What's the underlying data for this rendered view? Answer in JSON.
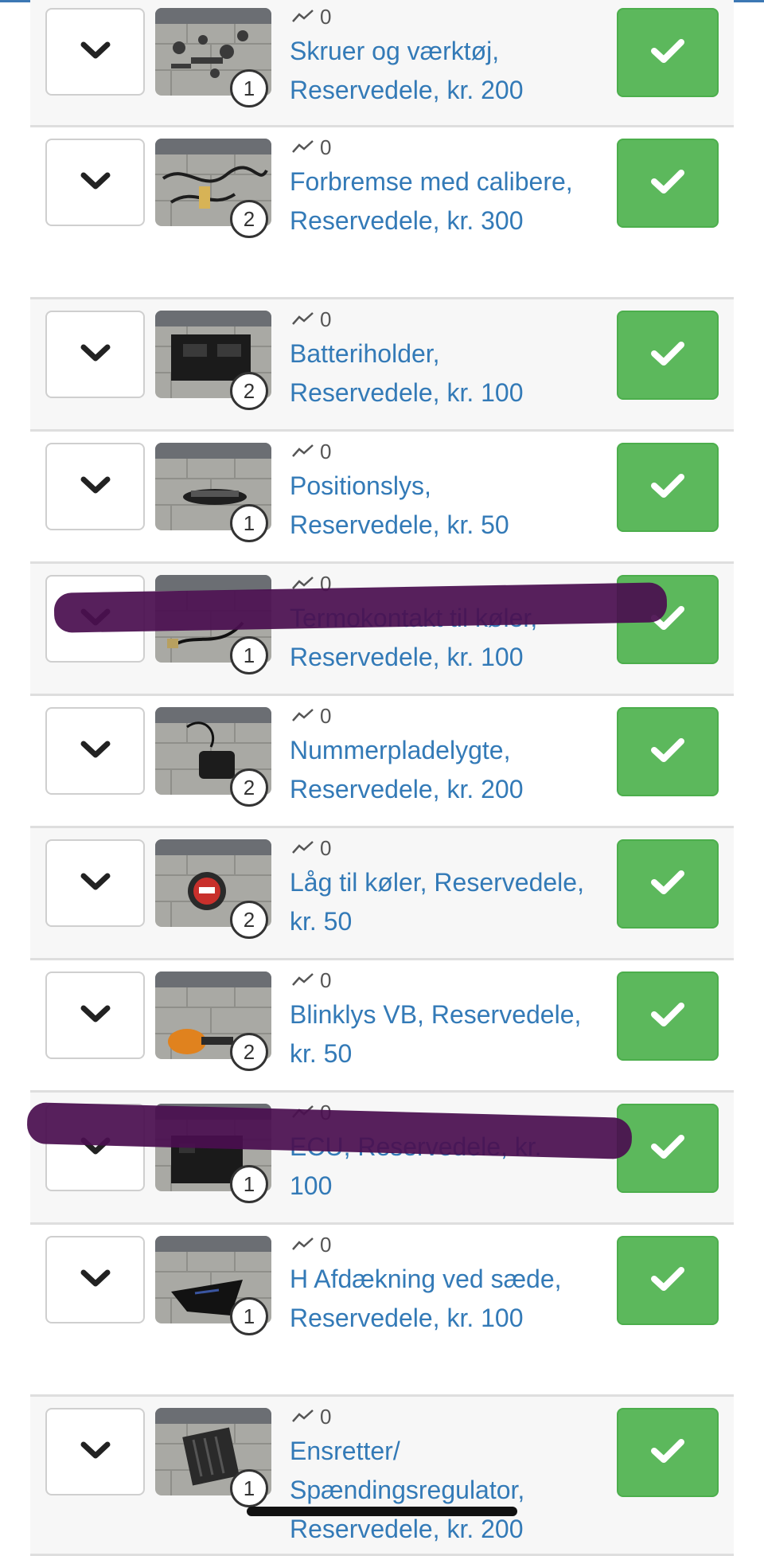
{
  "listing": {
    "items": [
      {
        "title": "Skruer og værktøj, Reservedele, kr. 200",
        "views": "0",
        "image_count": "1",
        "photo": "small-parts"
      },
      {
        "title": "Forbremse med calibere, Reservedele, kr. 300",
        "views": "0",
        "image_count": "2",
        "photo": "brake-cables"
      },
      {
        "title": "Batteriholder, Reservedele, kr. 100",
        "views": "0",
        "image_count": "2",
        "photo": "battery-holder"
      },
      {
        "title": "Positionslys, Reservedele, kr. 50",
        "views": "0",
        "image_count": "1",
        "photo": "position-light"
      },
      {
        "title": "Termokontakt til køler, Reservedele, kr. 100",
        "views": "0",
        "image_count": "1",
        "photo": "thermo-switch",
        "redacted": true
      },
      {
        "title": "Nummerpladelygte, Reservedele, kr. 200",
        "views": "0",
        "image_count": "2",
        "photo": "plate-light"
      },
      {
        "title": "Låg til køler, Reservedele, kr. 50",
        "views": "0",
        "image_count": "2",
        "photo": "radiator-cap"
      },
      {
        "title": "Blinklys VB, Reservedele, kr. 50",
        "views": "0",
        "image_count": "2",
        "photo": "turn-signal"
      },
      {
        "title": "ECU, Reservedele, kr. 100",
        "views": "0",
        "image_count": "1",
        "photo": "ecu",
        "redacted": true
      },
      {
        "title": "H Afdækning ved sæde, Reservedele, kr. 100",
        "views": "0",
        "image_count": "1",
        "photo": "seat-cover"
      },
      {
        "title": "Ensretter/ Spændingsregulator, Reservedele, kr. 200",
        "views": "0",
        "image_count": "1",
        "photo": "rectifier"
      }
    ]
  },
  "icons": {
    "expand": "chevron-down-icon",
    "views": "trend-line-icon",
    "confirm": "check-icon"
  },
  "colors": {
    "link": "#337ab7",
    "success": "#5cb85c",
    "success_border": "#4cae4c",
    "row_alt": "#f7f7f7",
    "divider": "#dedede",
    "redaction": "#4a0f50"
  }
}
